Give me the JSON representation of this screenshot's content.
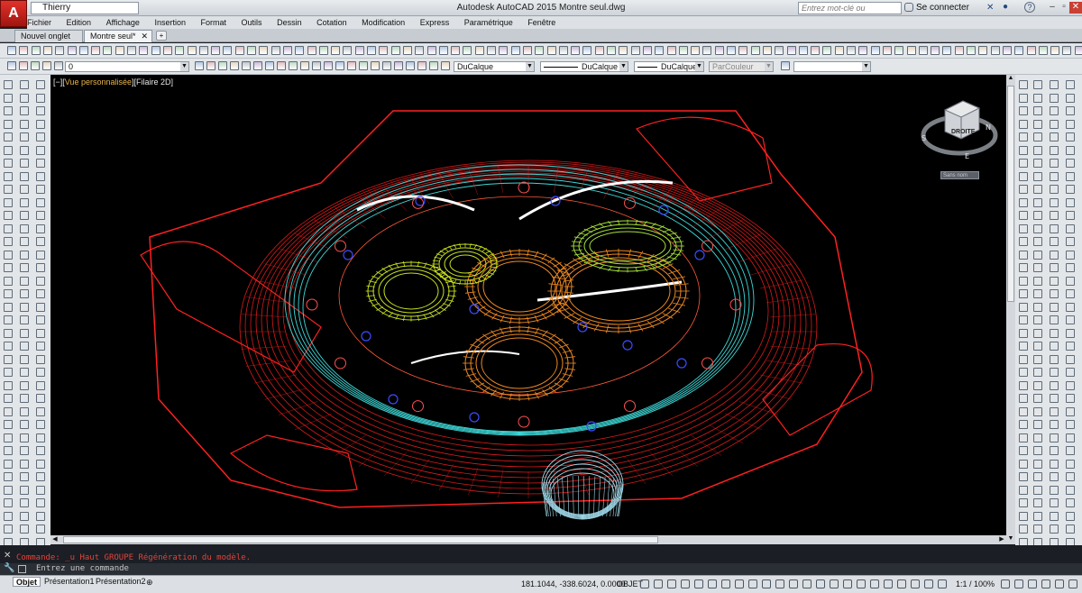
{
  "window": {
    "title": "Autodesk AutoCAD 2015    Montre seul.dwg",
    "workspace": "Thierry",
    "search_placeholder": "Entrez mot-clé ou expression",
    "signin": "Se connecter",
    "help": "?"
  },
  "menu": [
    "Fichier",
    "Edition",
    "Affichage",
    "Insertion",
    "Format",
    "Outils",
    "Dessin",
    "Cotation",
    "Modification",
    "Express",
    "Paramétrique",
    "Fenêtre"
  ],
  "tabs": [
    {
      "label": "Nouvel onglet",
      "active": false
    },
    {
      "label": "Montre seul*",
      "active": true
    }
  ],
  "layer_toolbar": {
    "layer": "0",
    "color": "DuCalque",
    "linetype": "DuCalque",
    "lineweight": "DuCalque",
    "plotstyle": "ParCouleur"
  },
  "viewport": {
    "label_prefix": "[−][",
    "label_view": "Vue personnalisée",
    "label_suffix": "][Filaire 2D]"
  },
  "viewcube": {
    "face": "DROITE",
    "north": "N",
    "south": "S",
    "east": "E",
    "wcs_button": "Sans nom"
  },
  "command": {
    "history": "Commande:  _u Haut GROUPE Régénération du modèle.",
    "prompt": "Entrez une commande"
  },
  "layout_tabs": [
    "Objet",
    "Présentation1",
    "Présentation2"
  ],
  "status": {
    "coords": "181.1044, -338.6024, 0.0000",
    "mode": "OBJET",
    "annotation_scale": "1:1 / 100%"
  },
  "colors": {
    "accent_red": "#ff2020",
    "cyan": "#3fd9d9",
    "orange": "#f08a22",
    "yellow_green": "#c8e020",
    "blue": "#3a4bff",
    "background": "#000000"
  }
}
